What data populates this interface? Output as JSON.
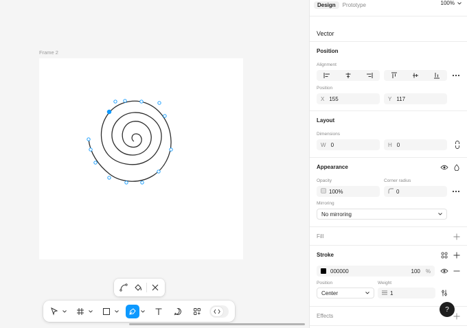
{
  "canvas": {
    "frame_label": "Frame 2"
  },
  "tabs": [
    {
      "label": "Design",
      "active": true
    },
    {
      "label": "Prototype",
      "active": false
    }
  ],
  "zoom": "100%",
  "vector": {
    "title": "Vector"
  },
  "position": {
    "title": "Position",
    "alignment_label": "Alignment",
    "position_label": "Position",
    "x_prefix": "X",
    "x_value": "155",
    "y_prefix": "Y",
    "y_value": "117"
  },
  "layout": {
    "title": "Layout",
    "dimensions_label": "Dimensions",
    "w_prefix": "W",
    "w_value": "0",
    "h_prefix": "H",
    "h_value": "0"
  },
  "appearance": {
    "title": "Appearance",
    "opacity_label": "Opacity",
    "opacity_value": "100%",
    "corner_label": "Corner radius",
    "corner_value": "0",
    "mirroring_label": "Mirroring",
    "mirroring_value": "No mirroring"
  },
  "fill": {
    "title": "Fill"
  },
  "stroke": {
    "title": "Stroke",
    "color_hex": "000000",
    "opacity": "100",
    "opacity_unit": "%",
    "position_label": "Position",
    "position_value": "Center",
    "weight_label": "Weight",
    "weight_value": "1"
  },
  "effects": {
    "title": "Effects"
  },
  "help": "?",
  "colors": {
    "accent": "#0d99ff",
    "stroke_swatch": "#000000"
  }
}
